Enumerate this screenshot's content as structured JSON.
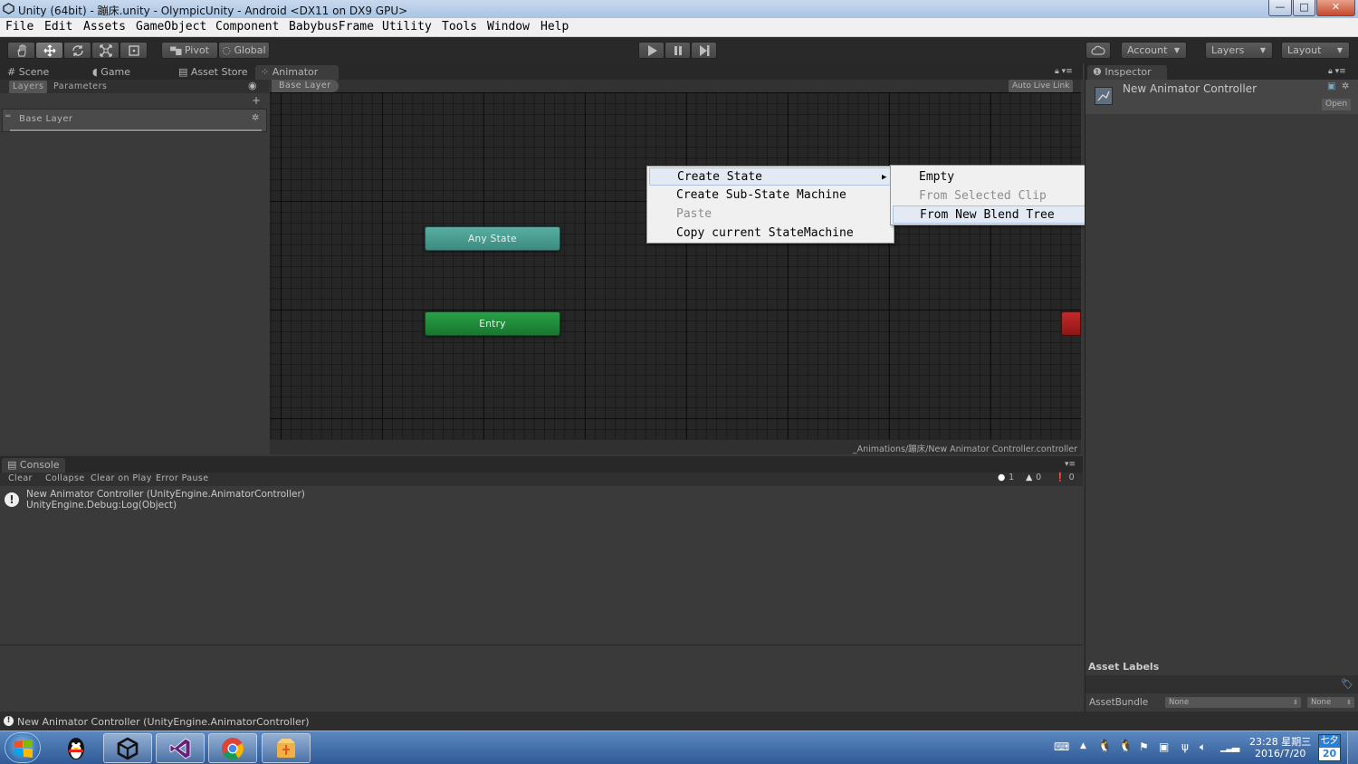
{
  "window": {
    "title": "Unity (64bit) - 蹦床.unity - OlympicUnity - Android <DX11 on DX9 GPU>",
    "buttons": {
      "minimize": "—",
      "maximize": "□",
      "close": "✕"
    }
  },
  "menu": [
    "File",
    "Edit",
    "Assets",
    "GameObject",
    "Component",
    "BabybusFrame",
    "Utility",
    "Tools",
    "Window",
    "Help"
  ],
  "toolbar": {
    "pivot_label": "Pivot",
    "global_label": "Global",
    "account_label": "Account",
    "layers_label": "Layers",
    "layout_label": "Layout"
  },
  "tabs": {
    "scene": "Scene",
    "game": "Game",
    "asset_store": "Asset Store",
    "animator": "Animator"
  },
  "animator": {
    "subtabs": {
      "layers": "Layers",
      "parameters": "Parameters"
    },
    "breadcrumb": "Base Layer",
    "auto_live_link": "Auto Live Link",
    "layer_name": "Base Layer",
    "nodes": {
      "any_state": "Any State",
      "entry": "Entry"
    },
    "path": "_Animations/蹦床/New Animator Controller.controller"
  },
  "context_menu": {
    "items": [
      "Create State",
      "Create Sub-State Machine",
      "Paste",
      "Copy current StateMachine"
    ],
    "submenu": [
      "Empty",
      "From Selected Clip",
      "From New Blend Tree"
    ]
  },
  "inspector": {
    "tab": "Inspector",
    "title": "New Animator Controller",
    "open_button": "Open",
    "asset_labels": "Asset Labels",
    "asset_bundle_label": "AssetBundle",
    "bundle_value": "None",
    "variant_value": "None"
  },
  "console": {
    "tab": "Console",
    "buttons": {
      "clear": "Clear",
      "collapse": "Collapse",
      "clear_on_play": "Clear on Play",
      "error_pause": "Error Pause"
    },
    "counts": {
      "info": "1",
      "warnings": "0",
      "errors": "0"
    },
    "log_line1": "New Animator Controller (UnityEngine.AnimatorController)",
    "log_line2": "UnityEngine.Debug:Log(Object)"
  },
  "status": "New Animator Controller (UnityEngine.AnimatorController)",
  "taskbar": {
    "clock_time": "23:28 星期三",
    "clock_date": "2016/7/20",
    "ime_top": "七夕",
    "ime_bottom": "20"
  },
  "colors": {
    "any_state": "#4a9a8f",
    "entry": "#1f8a3a",
    "exit": "#a61d1d",
    "menu_highlight": "#e3eaf4"
  }
}
